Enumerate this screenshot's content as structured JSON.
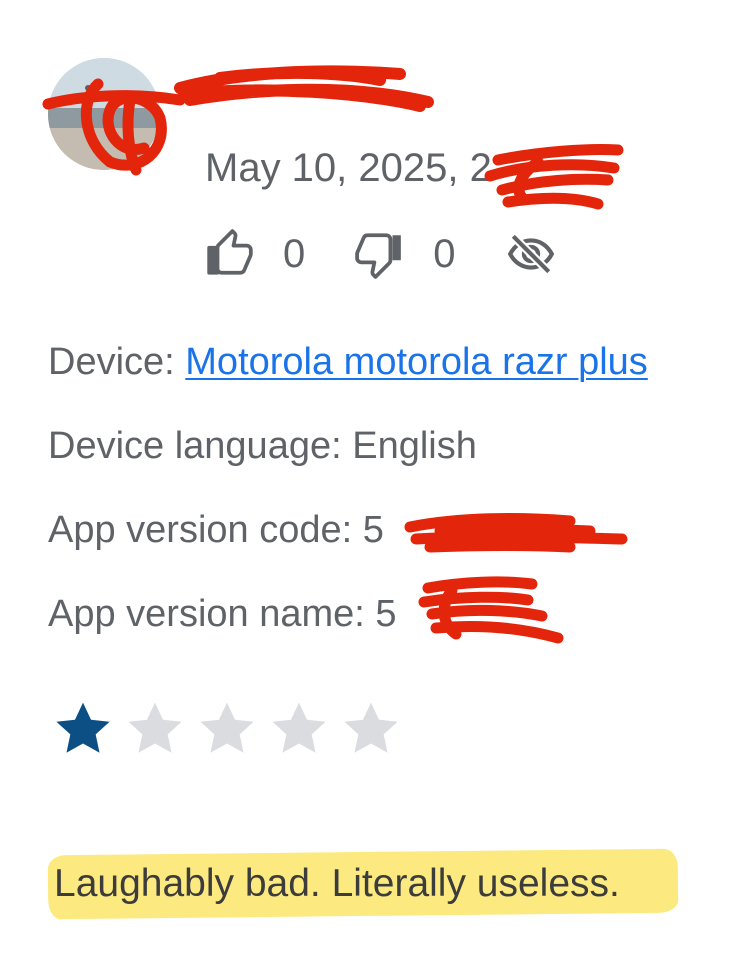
{
  "reviewer": {
    "name": "",
    "date": "May 10, 2025, 2"
  },
  "actions": {
    "thumbs_up_count": "0",
    "thumbs_down_count": "0",
    "hide_icon": "eye-off-icon"
  },
  "details": {
    "device_label": "Device: ",
    "device_value": "Motorola motorola razr plus",
    "language_label": "Device language: ",
    "language_value": "English",
    "version_code_label": "App version code: ",
    "version_code_value": "5",
    "version_name_label": "App version name: ",
    "version_name_value": "5"
  },
  "rating": {
    "value": 1,
    "max": 5,
    "filled_color": "#0b4f85",
    "empty_color": "#dadce0"
  },
  "review": {
    "text": "Laughably bad. Literally useless."
  },
  "colors": {
    "text": "#5f6368",
    "link": "#1a73e8",
    "redaction": "#e3250c",
    "highlight": "#fbe66a"
  }
}
